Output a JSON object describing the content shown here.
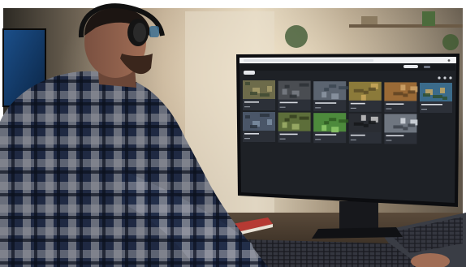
{
  "scene": {
    "description_icons": [
      "person-icon",
      "headphones-icon",
      "monitor-icon",
      "keyboard-icon",
      "laptop-icon"
    ]
  },
  "screen_app": {
    "search_placeholder": "",
    "tiles": [
      {
        "label": "",
        "kind": "aerial-map"
      },
      {
        "label": "",
        "kind": "aerial-map"
      },
      {
        "label": "",
        "kind": "aerial-map"
      },
      {
        "label": "",
        "kind": "aerial-map"
      },
      {
        "label": "",
        "kind": "aerial-map"
      },
      {
        "label": "",
        "kind": "aerial-map"
      },
      {
        "label": "",
        "kind": "aerial-map"
      },
      {
        "label": "",
        "kind": "aerial-map"
      },
      {
        "label": "",
        "kind": "aerial-map"
      },
      {
        "label": "",
        "kind": "aerial-map"
      },
      {
        "label": "",
        "kind": "aerial-map"
      }
    ]
  }
}
